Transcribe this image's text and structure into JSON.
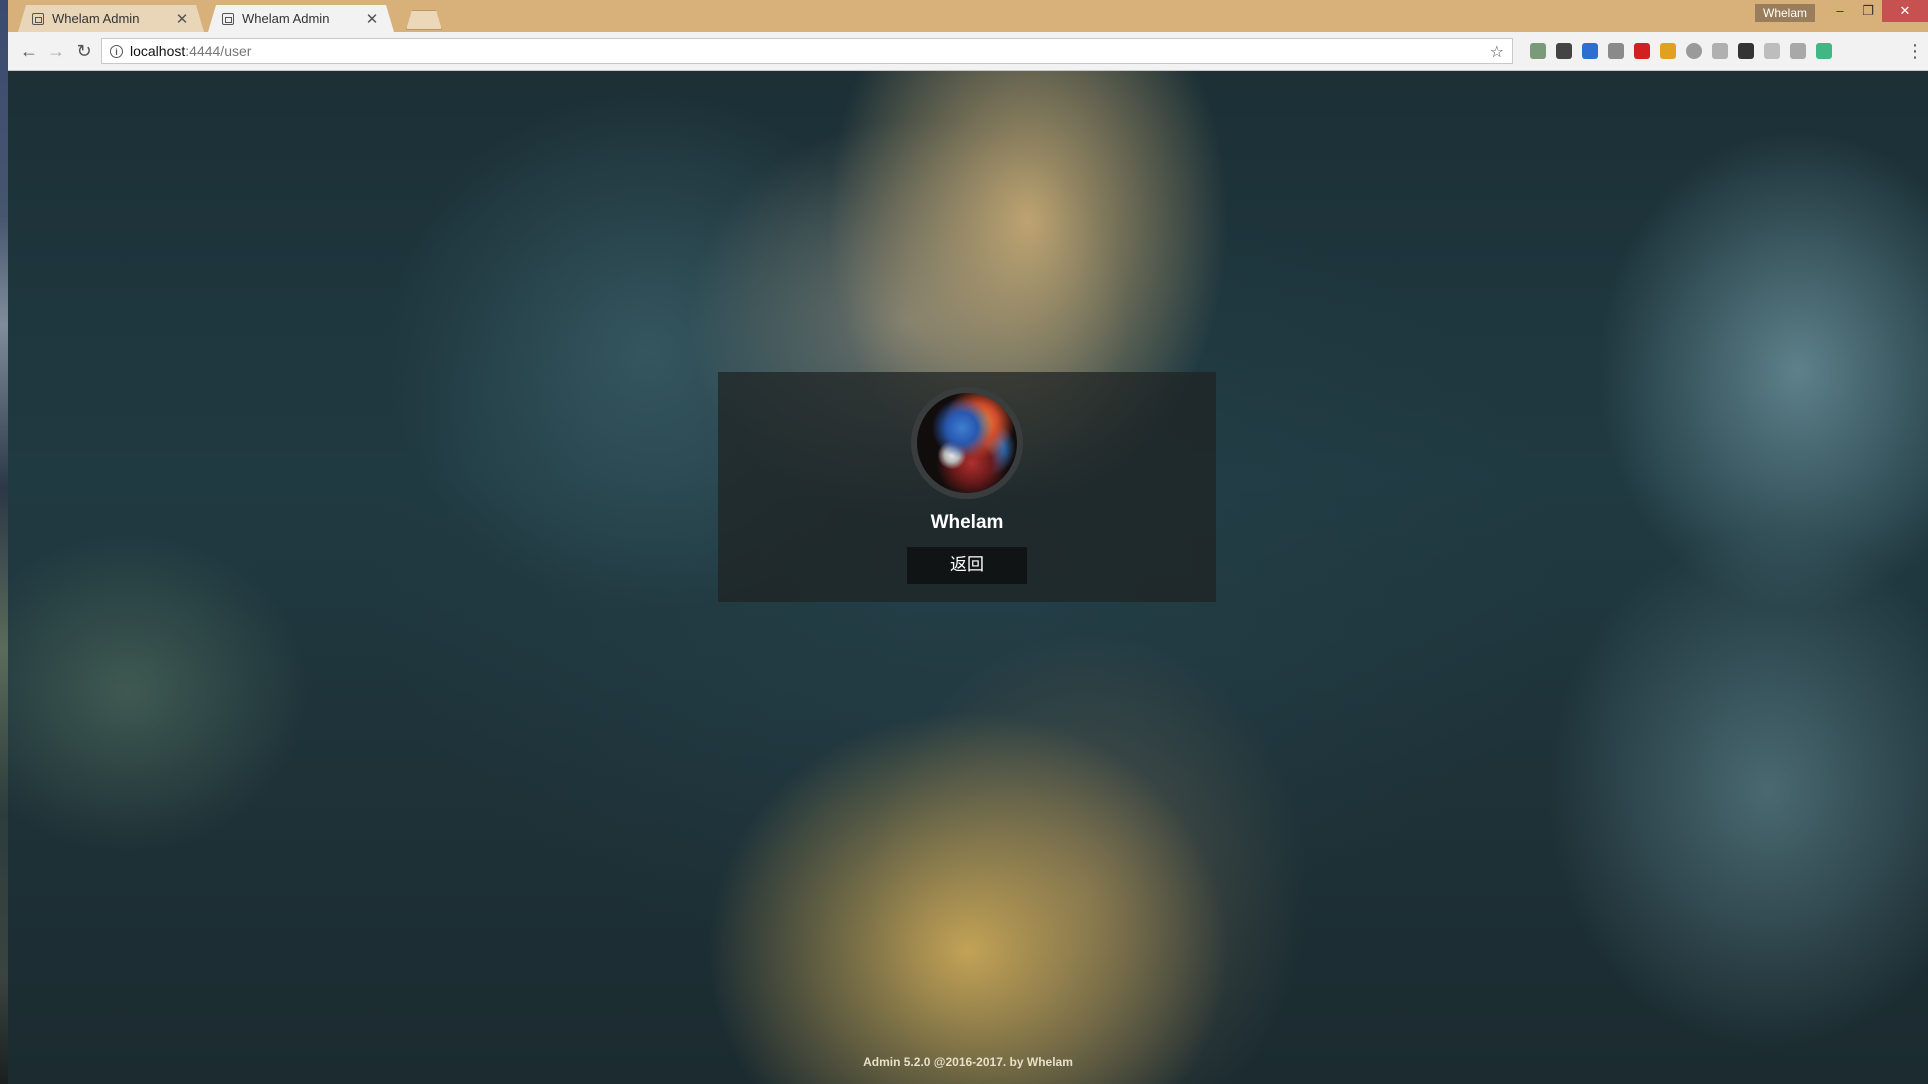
{
  "browser": {
    "tabs": [
      {
        "title": "Whelam Admin",
        "active": false
      },
      {
        "title": "Whelam Admin",
        "active": true
      }
    ],
    "profile_name": "Whelam",
    "window_controls": {
      "minimize": "–",
      "restore": "❐",
      "close": "✕"
    },
    "url_host": "localhost",
    "url_rest": ":4444/user",
    "extensions": [
      {
        "name": "extension-puzzle-icon",
        "color": "#7a9a7a"
      },
      {
        "name": "extension-glasses-icon",
        "color": "#444444"
      },
      {
        "name": "extension-new-icon",
        "color": "#2d6fd0"
      },
      {
        "name": "extension-card-icon",
        "color": "#8a8a8a"
      },
      {
        "name": "extension-fe-icon",
        "color": "#d02020"
      },
      {
        "name": "extension-colors-icon",
        "color": "#e0a020"
      },
      {
        "name": "extension-circle-icon",
        "color": "#9a9a9a"
      },
      {
        "name": "extension-flower-icon",
        "color": "#b0b0b0"
      },
      {
        "name": "extension-c-icon",
        "color": "#333333"
      },
      {
        "name": "extension-chart-icon",
        "color": "#bdbdbd"
      },
      {
        "name": "extension-box-icon",
        "color": "#a8a8a8"
      },
      {
        "name": "extension-vue-icon",
        "color": "#41b883"
      }
    ]
  },
  "page": {
    "user": {
      "name": "Whelam"
    },
    "back_label": "返回",
    "footer": "Admin 5.2.0 @2016-2017. by Whelam"
  }
}
